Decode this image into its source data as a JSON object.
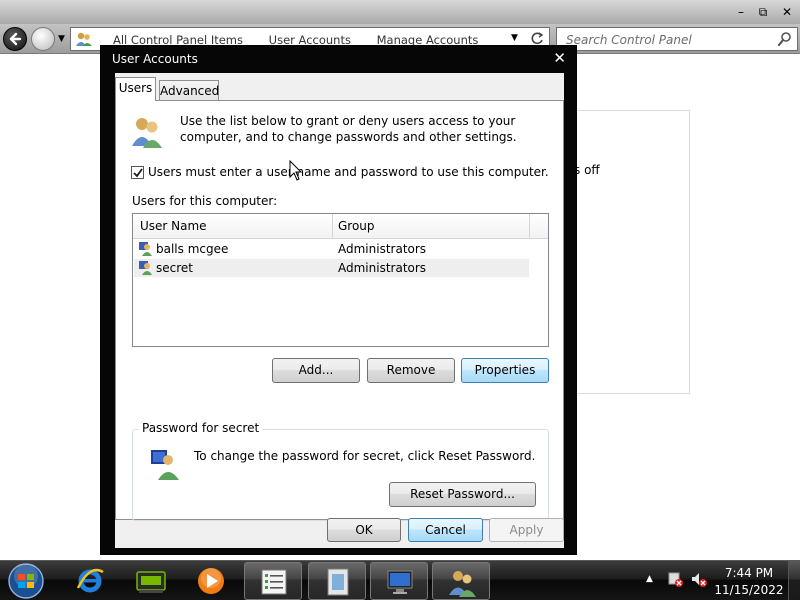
{
  "explorer": {
    "window_controls": {
      "minimize": "–",
      "maximize": "⧉",
      "close": "✕"
    },
    "breadcrumb": [
      "All Control Panel Items",
      "User Accounts",
      "Manage Accounts"
    ],
    "search_placeholder": "Search Control Panel",
    "background_text": "s off"
  },
  "dialog": {
    "title": "User Accounts",
    "close_glyph": "✕",
    "tabs": [
      {
        "label": "Users",
        "selected": true
      },
      {
        "label": "Advanced",
        "selected": false
      }
    ],
    "intro_text": "Use the list below to grant or deny users access to your computer, and to change passwords and other settings.",
    "require_password_label": "Users must enter a user name and password to use this computer.",
    "require_password_checked": true,
    "users_list_label": "Users for this computer:",
    "columns": [
      "User Name",
      "Group"
    ],
    "users": [
      {
        "name": "balls mcgee",
        "group": "Administrators",
        "selected": false
      },
      {
        "name": "secret",
        "group": "Administrators",
        "selected": true
      }
    ],
    "buttons": {
      "add": "Add...",
      "remove": "Remove",
      "properties": "Properties"
    },
    "password_group": {
      "title": "Password for secret",
      "text": "To change the password for secret, click Reset Password.",
      "reset_button": "Reset Password..."
    },
    "footer": {
      "ok": "OK",
      "cancel": "Cancel",
      "apply": "Apply"
    }
  },
  "taskbar": {
    "pinned": [
      "internet-explorer-icon",
      "nvidia-icon",
      "media-player-icon",
      "task-list-icon",
      "recycle-doc-icon",
      "remote-desktop-icon",
      "user-accounts-icon"
    ],
    "clock": {
      "time": "7:44 PM",
      "date": "11/15/2022"
    }
  },
  "colors": {
    "dialog_frame": "#060606",
    "button_focus": "#a7d9f5",
    "taskbar": "#151515"
  }
}
